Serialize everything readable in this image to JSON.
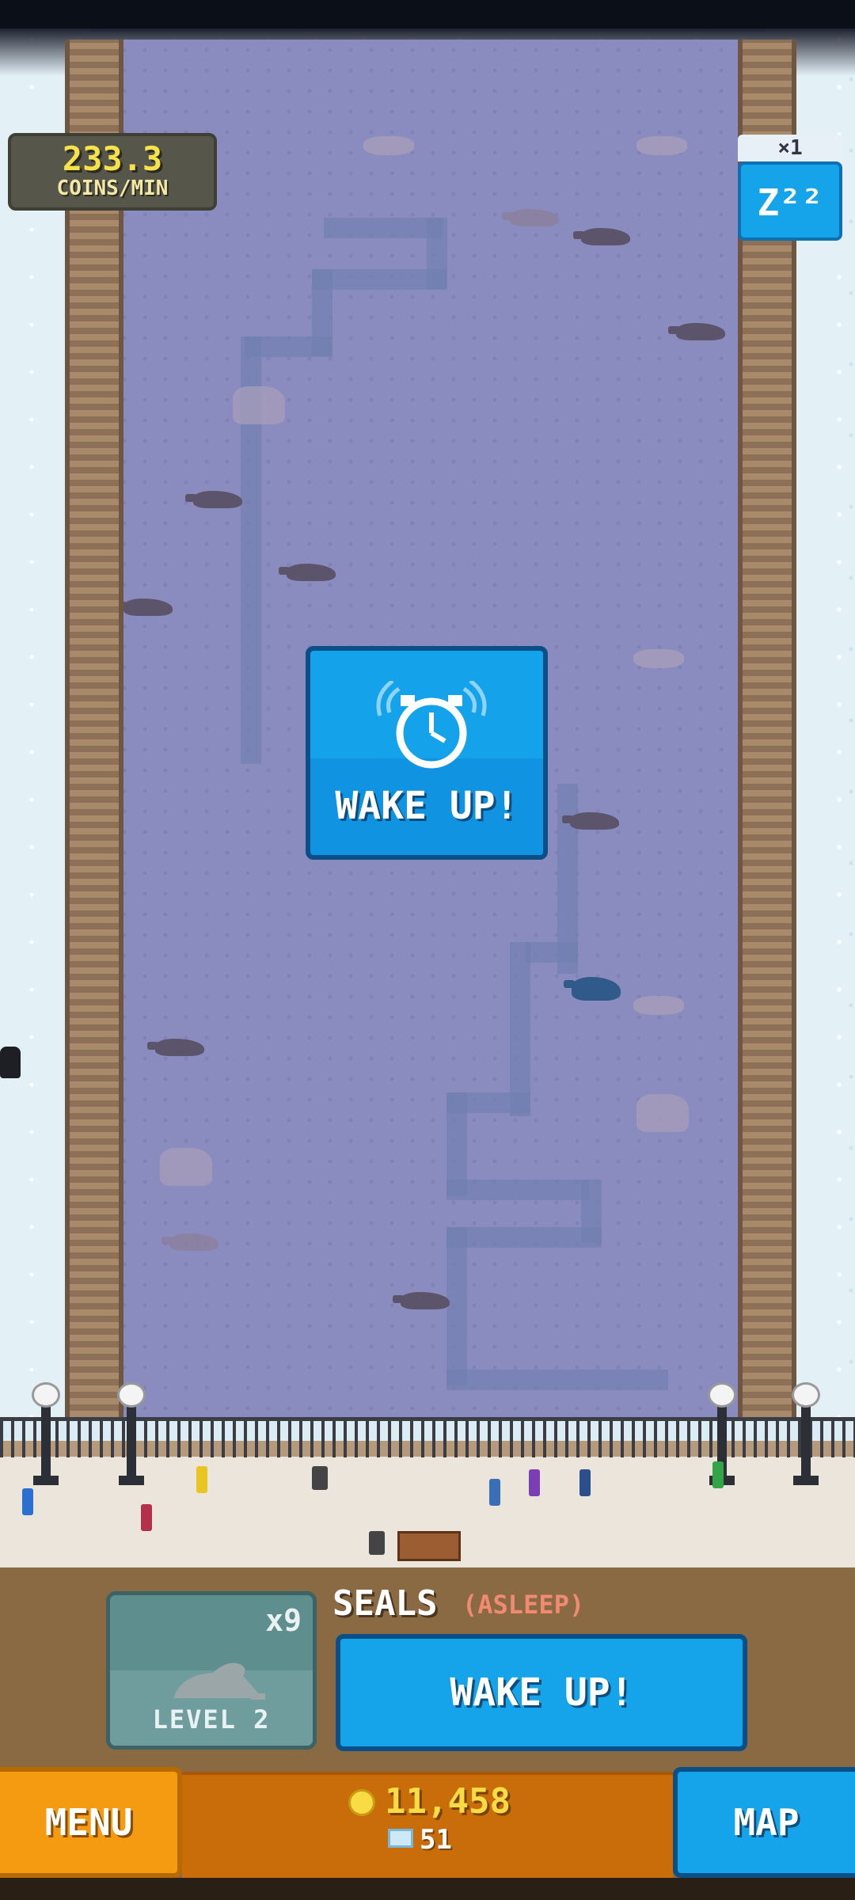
{
  "hud": {
    "rate_value": "233.3",
    "rate_unit": "COINS/MIN",
    "sleep_multiplier": "×1",
    "sleep_icon": "zzz-icon",
    "sleep_label": "Z²²"
  },
  "overlay": {
    "wake_label": "WAKE UP!",
    "icon": "alarm-clock-icon"
  },
  "exhibit": {
    "count": "x9",
    "level": "LEVEL 2",
    "name": "SEALS",
    "status": "(ASLEEP)",
    "wake_button": "WAKE UP!"
  },
  "bottom_bar": {
    "menu": "MENU",
    "coins": "11,458",
    "gems": "51",
    "map": "MAP"
  },
  "colors": {
    "accent_blue": "#15a3ea",
    "menu_orange": "#f49b12",
    "coin_yellow": "#f9dc45",
    "pool": "#8a8bbf"
  }
}
